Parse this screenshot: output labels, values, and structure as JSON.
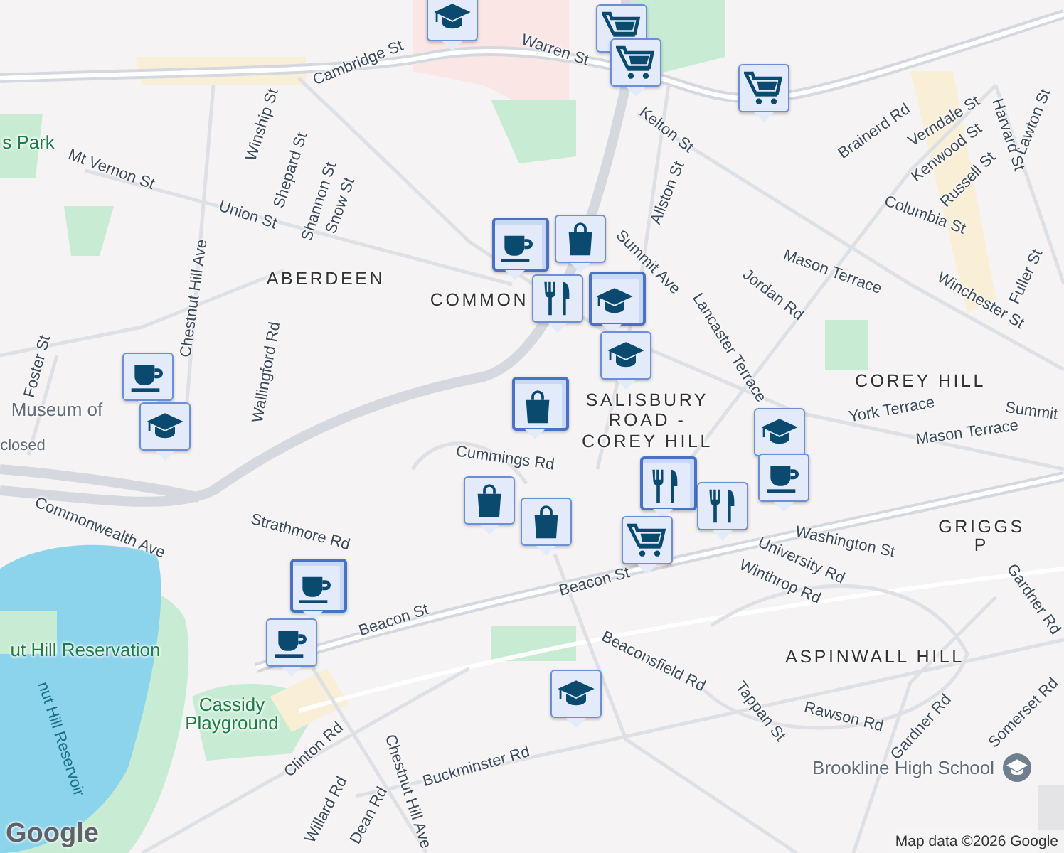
{
  "map": {
    "labels": [
      {
        "text": "Cambridge St",
        "kind": "street"
      },
      {
        "text": "Warren St",
        "kind": "street"
      },
      {
        "text": "Kelton St",
        "kind": "street"
      },
      {
        "text": "Allston St",
        "kind": "street"
      },
      {
        "text": "Brainerd Rd",
        "kind": "street"
      },
      {
        "text": "Harvard St",
        "kind": "street"
      },
      {
        "text": "Verndale St",
        "kind": "street"
      },
      {
        "text": "Kenwood St",
        "kind": "street"
      },
      {
        "text": "Russell St",
        "kind": "street"
      },
      {
        "text": "Lawton St",
        "kind": "street"
      },
      {
        "text": "Columbia St",
        "kind": "street"
      },
      {
        "text": "Summit Ave",
        "kind": "street"
      },
      {
        "text": "Mason Terrace",
        "kind": "street"
      },
      {
        "text": "Jordan Rd",
        "kind": "street"
      },
      {
        "text": "Winchester St",
        "kind": "street"
      },
      {
        "text": "Fuller St",
        "kind": "street"
      },
      {
        "text": "Lancaster Terrace",
        "kind": "street"
      },
      {
        "text": "York Terrace",
        "kind": "street"
      },
      {
        "text": "Mason Terrace",
        "kind": "street"
      },
      {
        "text": "Washington St",
        "kind": "street"
      },
      {
        "text": "Mt Vernon St",
        "kind": "street"
      },
      {
        "text": "Union St",
        "kind": "street"
      },
      {
        "text": "Winship St",
        "kind": "street"
      },
      {
        "text": "Shepard St",
        "kind": "street"
      },
      {
        "text": "Shannon St",
        "kind": "street"
      },
      {
        "text": "Snow St",
        "kind": "street"
      },
      {
        "text": "Chestnut Hill Ave",
        "kind": "street"
      },
      {
        "text": "Wallingford Rd",
        "kind": "street"
      },
      {
        "text": "Foster St",
        "kind": "street"
      },
      {
        "text": "Commonwealth Ave",
        "kind": "street"
      },
      {
        "text": "Strathmore Rd",
        "kind": "street"
      },
      {
        "text": "Cummings Rd",
        "kind": "street"
      },
      {
        "text": "Beacon St",
        "kind": "street"
      },
      {
        "text": "Beacon St",
        "kind": "street"
      },
      {
        "text": "University Rd",
        "kind": "street"
      },
      {
        "text": "Winthrop Rd",
        "kind": "street"
      },
      {
        "text": "Beaconsfield Rd",
        "kind": "street"
      },
      {
        "text": "Tappan St",
        "kind": "street"
      },
      {
        "text": "Rawson Rd",
        "kind": "street"
      },
      {
        "text": "Gardner Rd",
        "kind": "street"
      },
      {
        "text": "Somerset Rd",
        "kind": "street"
      },
      {
        "text": "Gardner Rd",
        "kind": "street"
      },
      {
        "text": "Chestnut Hill Ave",
        "kind": "street"
      },
      {
        "text": "Clinton Rd",
        "kind": "street"
      },
      {
        "text": "Buckminster Rd",
        "kind": "street"
      },
      {
        "text": "Dean Rd",
        "kind": "street"
      },
      {
        "text": "Willard Rd",
        "kind": "street"
      },
      {
        "text": "Summit",
        "kind": "street"
      },
      {
        "text": "ABERDEEN",
        "kind": "area"
      },
      {
        "text": "COMMON",
        "kind": "area"
      },
      {
        "text": "COREY HILL",
        "kind": "area"
      },
      {
        "text": "SALISBURY ROAD - COREY HILL",
        "kind": "area"
      },
      {
        "text": "ASPINWALL HILL",
        "kind": "area"
      },
      {
        "text": "GRIGGS P",
        "kind": "area"
      },
      {
        "text": "ut Hill Reservation",
        "kind": "park"
      },
      {
        "text": "Cassidy Playground",
        "kind": "park"
      },
      {
        "text": "s Park",
        "kind": "park"
      },
      {
        "text": "nut Hill Reservoir",
        "kind": "water"
      },
      {
        "text": "Museum of",
        "kind": "poi"
      },
      {
        "text": "closed",
        "kind": "poi"
      },
      {
        "text": "Brookline High School",
        "kind": "poi"
      }
    ],
    "pins": [
      {
        "kind": "school",
        "stacked": false
      },
      {
        "kind": "grocery",
        "stacked": false
      },
      {
        "kind": "grocery",
        "stacked": false
      },
      {
        "kind": "grocery",
        "stacked": false
      },
      {
        "kind": "cafe",
        "stacked": true
      },
      {
        "kind": "shop",
        "stacked": false
      },
      {
        "kind": "restaurant",
        "stacked": false
      },
      {
        "kind": "school",
        "stacked": true
      },
      {
        "kind": "school",
        "stacked": false
      },
      {
        "kind": "shop",
        "stacked": true
      },
      {
        "kind": "cafe",
        "stacked": false
      },
      {
        "kind": "school",
        "stacked": false
      },
      {
        "kind": "school",
        "stacked": false
      },
      {
        "kind": "shop",
        "stacked": false
      },
      {
        "kind": "shop",
        "stacked": false
      },
      {
        "kind": "restaurant",
        "stacked": true
      },
      {
        "kind": "grocery",
        "stacked": false
      },
      {
        "kind": "restaurant",
        "stacked": false
      },
      {
        "kind": "cafe",
        "stacked": false
      },
      {
        "kind": "cafe",
        "stacked": true
      },
      {
        "kind": "cafe",
        "stacked": false
      },
      {
        "kind": "school",
        "stacked": false
      }
    ]
  },
  "footer": {
    "logo": "Google",
    "attribution": "Map data ©2026 Google"
  }
}
